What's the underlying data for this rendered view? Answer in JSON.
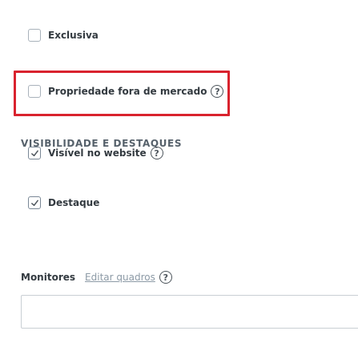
{
  "options": {
    "exclusiva": {
      "label": "Exclusiva",
      "checked": false
    },
    "fora_mercado": {
      "label": "Propriedade fora de mercado",
      "checked": false
    }
  },
  "section": {
    "title": "VISIBILIDADE E DESTAQUES",
    "visivel": {
      "label": "Visível no website",
      "checked": true
    },
    "destaque": {
      "label": "Destaque",
      "checked": true
    }
  },
  "monitores": {
    "label": "Monitores",
    "edit_link": "Editar quadros",
    "input_value": ""
  },
  "help_glyph": "?",
  "colors": {
    "highlight_border": "#d9232e",
    "link": "#8c9aa6"
  }
}
